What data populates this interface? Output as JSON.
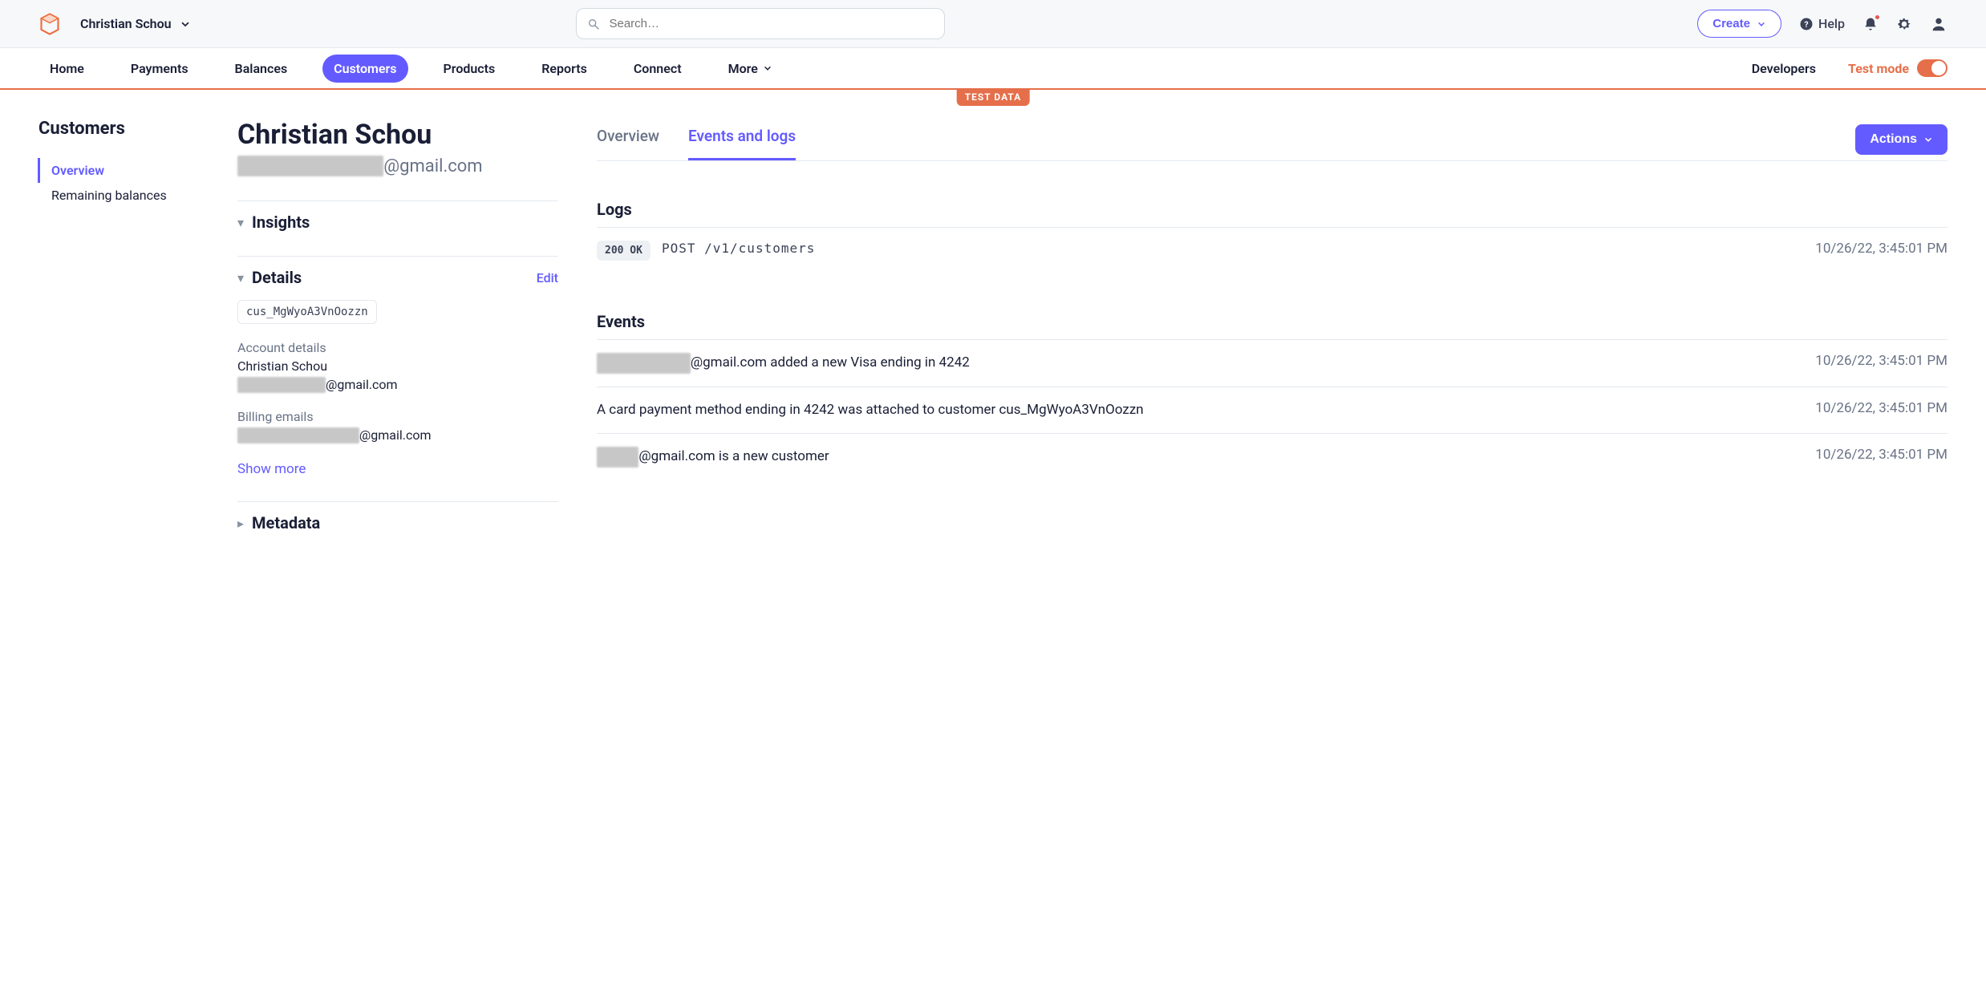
{
  "top": {
    "account_name": "Christian Schou",
    "search_placeholder": "Search…",
    "create_label": "Create",
    "help_label": "Help"
  },
  "nav": {
    "items": [
      "Home",
      "Payments",
      "Balances",
      "Customers",
      "Products",
      "Reports",
      "Connect",
      "More"
    ],
    "active_index": 3,
    "developers": "Developers",
    "test_mode": "Test mode",
    "test_data_badge": "TEST DATA"
  },
  "sidebar": {
    "heading": "Customers",
    "items": [
      "Overview",
      "Remaining balances"
    ],
    "active_index": 0
  },
  "customer": {
    "name": "Christian Schou",
    "email_redacted_prefix": "██████  ██  ███",
    "email_suffix": "@gmail.com",
    "sections": {
      "insights": {
        "title": "Insights"
      },
      "details": {
        "title": "Details",
        "edit": "Edit",
        "customer_id": "cus_MgWyoA3VnOozzn",
        "account_details_label": "Account details",
        "account_name": "Christian Schou",
        "account_email_redacted_prefix": "████  ██  ███  ",
        "account_email_suffix": "@gmail.com",
        "billing_label": "Billing emails",
        "billing_email_redacted_prefix": "███  ██ ██  ███  ██",
        "billing_email_suffix": "@gmail.com",
        "show_more": "Show more"
      },
      "metadata": {
        "title": "Metadata"
      }
    }
  },
  "rightpane": {
    "tabs": [
      "Overview",
      "Events and logs"
    ],
    "active_tab_index": 1,
    "actions_label": "Actions",
    "logs": {
      "heading": "Logs",
      "entries": [
        {
          "status": "200 OK",
          "method": "POST",
          "path": "/v1/customers",
          "ts": "10/26/22, 3:45:01 PM"
        }
      ]
    },
    "events": {
      "heading": "Events",
      "entries": [
        {
          "redacted_prefix": "███  ██  ████ ",
          "text_suffix": "@gmail.com added a new Visa ending in 4242",
          "ts": "10/26/22, 3:45:01 PM"
        },
        {
          "redacted_prefix": "",
          "text_suffix": "A card payment method ending in 4242 was attached to customer cus_MgWyoA3VnOozzn",
          "ts": "10/26/22, 3:45:01 PM"
        },
        {
          "redacted_prefix": "██                             ██ ",
          "text_suffix": "@gmail.com is a new customer",
          "ts": "10/26/22, 3:45:01 PM"
        }
      ]
    }
  }
}
